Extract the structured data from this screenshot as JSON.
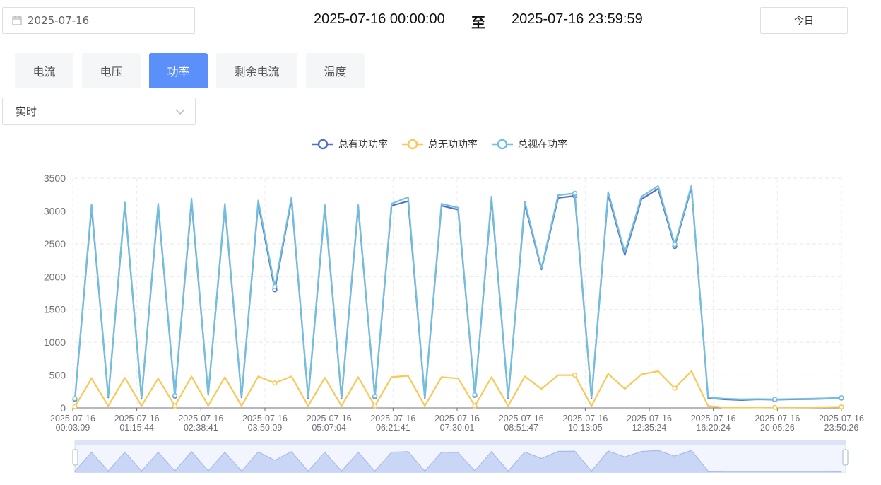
{
  "date_picker": {
    "value": "2025-07-16",
    "icon": "calendar-icon"
  },
  "time_range": {
    "start": "2025-07-16 00:00:00",
    "separator": "至",
    "end": "2025-07-16 23:59:59"
  },
  "today_button": "今日",
  "tabs": [
    {
      "label": "电流",
      "active": false
    },
    {
      "label": "电压",
      "active": false
    },
    {
      "label": "功率",
      "active": true
    },
    {
      "label": "剩余电流",
      "active": false
    },
    {
      "label": "温度",
      "active": false
    }
  ],
  "mode_select": {
    "value": "实时",
    "icon": "chevron-down-icon"
  },
  "colors": {
    "accent": "#5b8ff9",
    "active": "#5470c6",
    "reactive": "#fac858",
    "apparent": "#73c0de"
  },
  "chart_data": {
    "type": "line",
    "title": "",
    "xlabel": "",
    "ylabel": "",
    "ylim": [
      0,
      3500
    ],
    "yticks": [
      0,
      500,
      1000,
      1500,
      2000,
      2500,
      3000,
      3500
    ],
    "grid": true,
    "legend_position": "top-center",
    "categories": [
      "2025-07-16 00:03:09",
      "2025-07-16 01:15:44",
      "2025-07-16 02:38:41",
      "2025-07-16 03:50:09",
      "2025-07-16 05:07:04",
      "2025-07-16 06:21:41",
      "2025-07-16 07:30:01",
      "2025-07-16 08:51:47",
      "2025-07-16 10:13:05",
      "2025-07-16 12:35:24",
      "2025-07-16 16:20:24",
      "2025-07-16 20:05:26",
      "2025-07-16 23:50:26"
    ],
    "series": [
      {
        "name": "总有功功率",
        "color": "#5470c6",
        "values": [
          130,
          3060,
          160,
          3100,
          150,
          3080,
          180,
          3150,
          200,
          3080,
          160,
          3120,
          1800,
          3180,
          150,
          3060,
          150,
          3060,
          170,
          3080,
          3150,
          150,
          3080,
          3020,
          190,
          3180,
          150,
          3100,
          2110,
          3200,
          3230,
          150,
          3250,
          2330,
          3180,
          3340,
          2460,
          3360,
          150,
          130,
          120,
          130,
          125,
          130,
          135,
          140,
          150
        ]
      },
      {
        "name": "总无功功率",
        "color": "#fac858",
        "values": [
          20,
          450,
          30,
          460,
          30,
          450,
          30,
          480,
          35,
          470,
          30,
          480,
          380,
          480,
          30,
          460,
          30,
          470,
          30,
          470,
          490,
          30,
          470,
          450,
          30,
          470,
          30,
          480,
          290,
          500,
          500,
          30,
          520,
          290,
          510,
          560,
          300,
          560,
          30,
          5,
          5,
          6,
          8,
          8,
          10,
          12,
          15
        ]
      },
      {
        "name": "总视在功率",
        "color": "#73c0de",
        "values": [
          140,
          3100,
          170,
          3130,
          160,
          3110,
          190,
          3190,
          210,
          3110,
          170,
          3160,
          1850,
          3210,
          160,
          3090,
          160,
          3090,
          180,
          3110,
          3210,
          160,
          3110,
          3050,
          200,
          3220,
          160,
          3140,
          2130,
          3240,
          3270,
          160,
          3290,
          2370,
          3220,
          3380,
          2490,
          3390,
          160,
          140,
          130,
          135,
          130,
          135,
          140,
          145,
          155
        ]
      }
    ]
  }
}
